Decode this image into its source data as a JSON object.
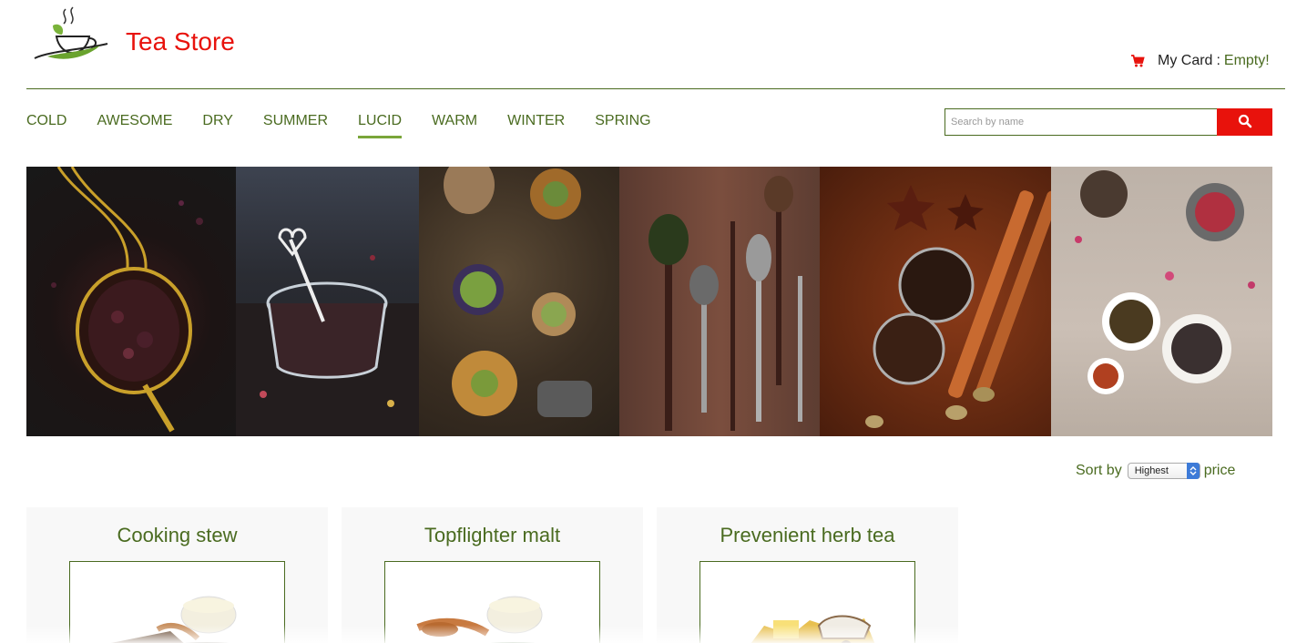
{
  "header": {
    "brand_name": "Tea Store",
    "logo_icon": "teacup-leaf-logo"
  },
  "cart": {
    "label": "My Card",
    "separator": ":",
    "status": "Empty!",
    "icon": "cart-icon"
  },
  "nav": {
    "items": [
      "COLD",
      "AWESOME",
      "DRY",
      "SUMMER",
      "LUCID",
      "WARM",
      "WINTER",
      "SPRING"
    ],
    "active": "LUCID"
  },
  "search": {
    "placeholder": "Search by name",
    "value": "",
    "button_icon": "search-icon"
  },
  "sort": {
    "label_before": "Sort by",
    "selected": "Highest",
    "label_after": "price"
  },
  "products": [
    {
      "name": "Cooking stew"
    },
    {
      "name": "Topflighter malt"
    },
    {
      "name": "Prevenient herb tea"
    }
  ],
  "colors": {
    "accent_red": "#e8120c",
    "brand_green": "#4a6b20",
    "active_underline": "#7aa63a"
  }
}
